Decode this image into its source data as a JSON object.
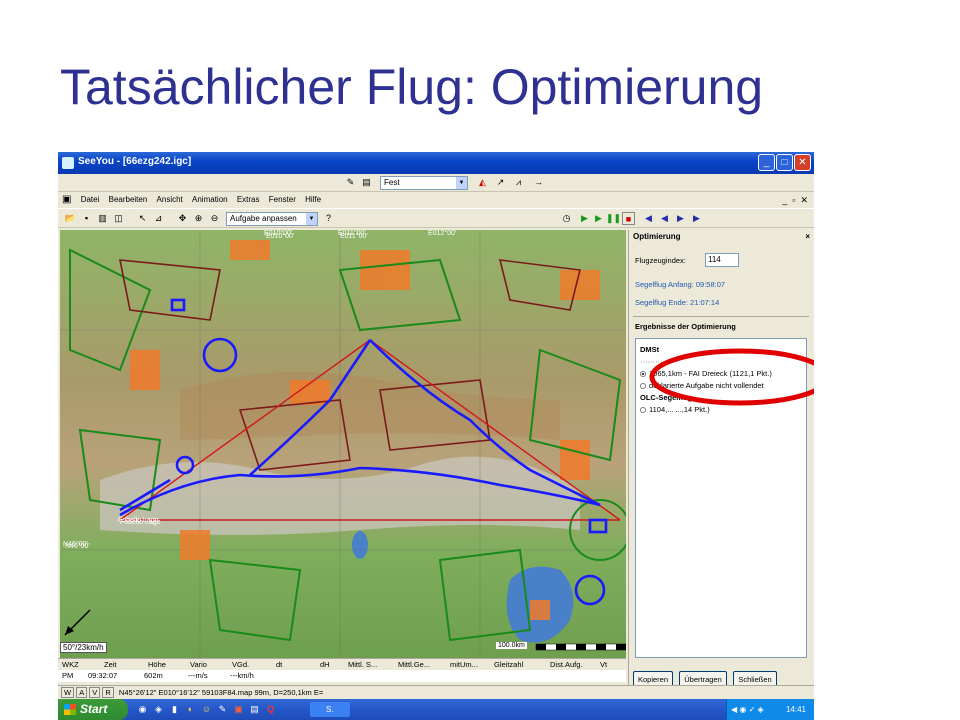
{
  "slide": {
    "title": "Tatsächlicher Flug: Optimierung"
  },
  "window": {
    "title": "SeeYou - [66ezg242.igc]"
  },
  "toolbar_top": {
    "view_combo": "Fest"
  },
  "menu": [
    "Datei",
    "Bearbeiten",
    "Ansicht",
    "Animation",
    "Extras",
    "Fenster",
    "Hilfe"
  ],
  "toolbar2": {
    "zoom_combo": "Aufgabe anpassen"
  },
  "map": {
    "scale_label": "50°/23km/h",
    "km_label": "100.0km",
    "coords": [
      "E010°00'",
      "E011°00'",
      "E012°00'",
      "N46°00'"
    ],
    "place_label": "Fobello Lago"
  },
  "panel": {
    "title": "Optimierung",
    "close": "×",
    "aircraft_index_label": "Flugzeugindex:",
    "aircraft_index_value": "114",
    "start_line": "Segelflug Anfang: 09:58:07",
    "end_line": "Segelflug Ende:  21:07:14",
    "results_label": "Ergebnisse der Optimierung",
    "groups": [
      {
        "name": "DMSt",
        "items": [
          {
            "text": "1065,1km - FAI Dreieck (1121,1 Pkt.)",
            "selected": true
          },
          {
            "text": "deklarierte Aufgabe nicht vollendet",
            "selected": false
          }
        ]
      },
      {
        "name": "OLC-Segelflug",
        "items": [
          {
            "text": "1104,...  ...,14 Pkt.)",
            "selected": false
          }
        ]
      }
    ],
    "buttons": [
      "Kopieren",
      "Übertragen",
      "Schließen"
    ]
  },
  "flight_table": {
    "headers": [
      "WKZ",
      "Zeit",
      "Höhe",
      "Vario",
      "VGd.",
      "dt",
      "dH",
      "Mittl. S...",
      "Mittl.Ge...",
      "mitUm...",
      "Gleitzahl",
      "Dist.Aufg.",
      "Vt"
    ],
    "row": [
      "PM",
      "09:32:07",
      "602m",
      "---m/s",
      "---km/h"
    ]
  },
  "statusbar": {
    "tabs": [
      "W",
      "A",
      "V",
      "R"
    ],
    "text": "N45°26'12\" E010°16'12\" 59103F84.map 99m, D=250,1km E="
  },
  "taskbar": {
    "start_label": "Start",
    "task_label": "S.",
    "clock": "14:41"
  },
  "colors": {
    "title_blue": "#2e3192",
    "highlight_ring": "#e00000",
    "flight_track": "#1a1aff",
    "xp_blue": "#0a46c8"
  }
}
